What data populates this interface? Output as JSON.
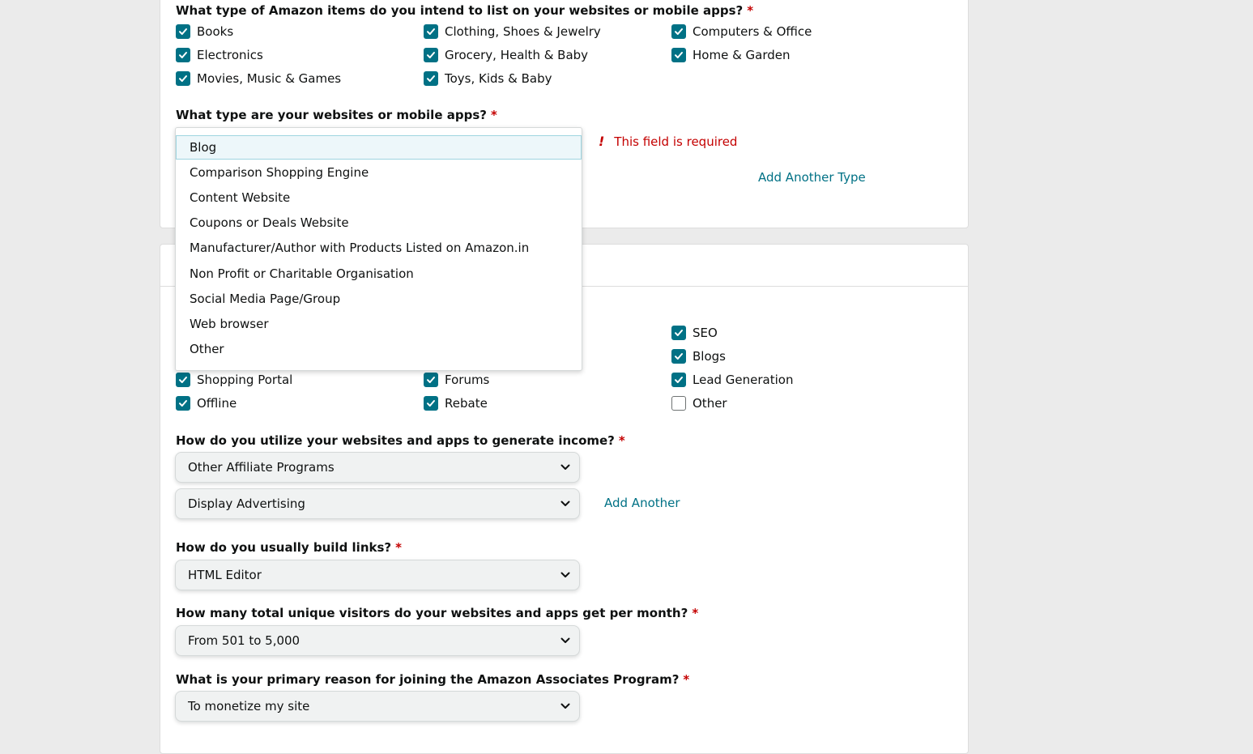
{
  "accent_color": "#007185",
  "required_color": "#c40000",
  "required_mark": "*",
  "icons": {
    "checkbox": "check-icon",
    "select": "chevron-down-icon",
    "error": "exclamation-icon"
  },
  "items_question": "What type of Amazon items do you intend to list on your websites or mobile apps?",
  "items": [
    {
      "label": "Books",
      "checked": true
    },
    {
      "label": "Clothing, Shoes & Jewelry",
      "checked": true
    },
    {
      "label": "Computers & Office",
      "checked": true
    },
    {
      "label": "Electronics",
      "checked": true
    },
    {
      "label": "Grocery, Health & Baby",
      "checked": true
    },
    {
      "label": "Home & Garden",
      "checked": true
    },
    {
      "label": "Movies, Music & Games",
      "checked": true
    },
    {
      "label": "Toys, Kids & Baby",
      "checked": true
    }
  ],
  "type_question": "What type are your websites or mobile apps?",
  "type_error": "This field is required",
  "add_another_type": "Add Another Type",
  "type_dropdown": {
    "highlighted": "Blog",
    "options": [
      "Blog",
      "Comparison Shopping Engine",
      "Content Website",
      "Coupons or Deals Website",
      "Manufacturer/Author with Products Listed on Amazon.in",
      "Non Profit or Charitable Organisation",
      "Social Media Page/Group",
      "Web browser",
      "Other"
    ]
  },
  "traffic": [
    {
      "label": "SEO",
      "checked": true
    },
    {
      "label": "Blogs",
      "checked": true
    },
    {
      "label": "Shopping Portal",
      "checked": true
    },
    {
      "label": "Forums",
      "checked": true
    },
    {
      "label": "Lead Generation",
      "checked": true
    },
    {
      "label": "Offline",
      "checked": true
    },
    {
      "label": "Rebate",
      "checked": true
    },
    {
      "label": "Other",
      "checked": false
    }
  ],
  "income_question": "How do you utilize your websites and apps to generate income?",
  "income_selects": [
    "Other Affiliate Programs",
    "Display Advertising"
  ],
  "add_another": "Add Another",
  "links_question": "How do you usually build links?",
  "links_value": "HTML Editor",
  "visitors_question": "How many total unique visitors do your websites and apps get per month?",
  "visitors_value": "From 501 to 5,000",
  "reason_question": "What is your primary reason for joining the Amazon Associates Program?",
  "reason_value": "To monetize my site"
}
